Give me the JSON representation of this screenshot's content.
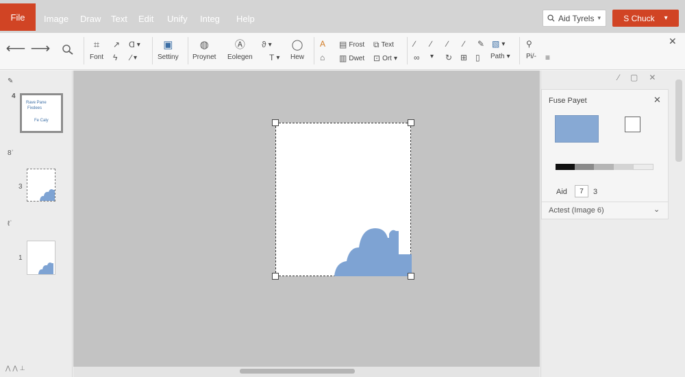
{
  "menu": {
    "file": "File",
    "items": [
      "Image",
      "Draw",
      "Text",
      "Edit",
      "Unify",
      "Integ",
      "Help"
    ]
  },
  "search": {
    "value": "Aid Tyrels"
  },
  "cta": {
    "label": "S Chuck"
  },
  "ribbon": {
    "labels": {
      "font": "Font",
      "settings": "Settiny",
      "property": "Proynet",
      "edit_design": "Eolegen",
      "new": "Hew",
      "format_text": "Frost",
      "text": "Text",
      "insert": "Dwet",
      "ort": "Ort",
      "path": "Path",
      "more": "Pi/-"
    }
  },
  "thumbnails": {
    "numbers": [
      "4",
      "3",
      "1"
    ],
    "slide1_lines": [
      "Rave Pane",
      "Fixdees",
      "Fe Caly"
    ]
  },
  "panel": {
    "title": "Fuse Payet",
    "row_label": "Aid",
    "row_input": "7",
    "row_value": "3",
    "dropdown": "Actest (Image 6)",
    "colors": {
      "swatch": "#87a9d4",
      "gradient": [
        "#111111",
        "#8a8a8a",
        "#b5b5b5",
        "#d4d4d4",
        "#ececec"
      ]
    }
  },
  "colors": {
    "accent": "#d14424",
    "shape": "#7ea3d3"
  }
}
